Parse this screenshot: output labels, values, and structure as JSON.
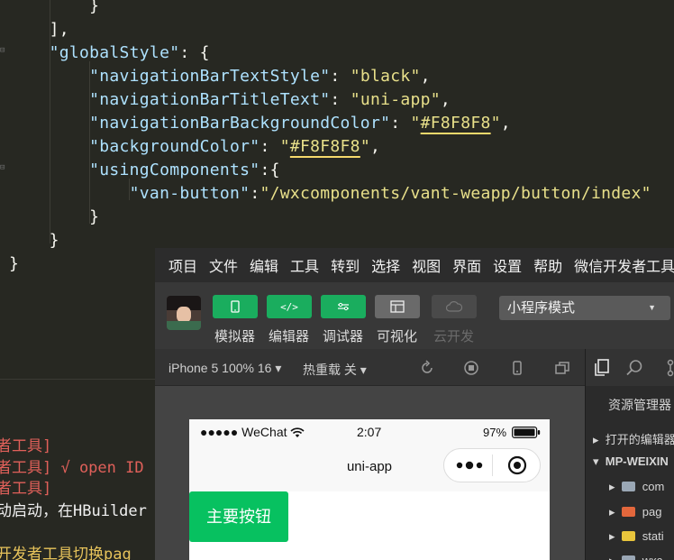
{
  "editor": {
    "lines": [
      {
        "indent": "        ",
        "parts": [
          {
            "t": "}",
            "c": "p"
          }
        ]
      },
      {
        "indent": "    ",
        "parts": [
          {
            "t": "],",
            "c": "p"
          }
        ]
      },
      {
        "indent": "    ",
        "parts": [
          {
            "t": "\"globalStyle\"",
            "c": "k"
          },
          {
            "t": ": {",
            "c": "p"
          }
        ]
      },
      {
        "indent": "        ",
        "parts": [
          {
            "t": "\"navigationBarTextStyle\"",
            "c": "k"
          },
          {
            "t": ": ",
            "c": "p"
          },
          {
            "t": "\"black\"",
            "c": "s"
          },
          {
            "t": ",",
            "c": "p"
          }
        ]
      },
      {
        "indent": "        ",
        "parts": [
          {
            "t": "\"navigationBarTitleText\"",
            "c": "k"
          },
          {
            "t": ": ",
            "c": "p"
          },
          {
            "t": "\"uni-app\"",
            "c": "s"
          },
          {
            "t": ",",
            "c": "p"
          }
        ]
      },
      {
        "indent": "        ",
        "parts": [
          {
            "t": "\"navigationBarBackgroundColor\"",
            "c": "k"
          },
          {
            "t": ": ",
            "c": "p"
          },
          {
            "t": "\"",
            "c": "s"
          },
          {
            "t": "#F8F8F8",
            "c": "s ul"
          },
          {
            "t": "\"",
            "c": "s"
          },
          {
            "t": ",",
            "c": "p"
          }
        ]
      },
      {
        "indent": "        ",
        "parts": [
          {
            "t": "\"backgroundColor\"",
            "c": "k"
          },
          {
            "t": ": ",
            "c": "p"
          },
          {
            "t": "\"",
            "c": "s"
          },
          {
            "t": "#F8F8F8",
            "c": "s ul"
          },
          {
            "t": "\"",
            "c": "s"
          },
          {
            "t": ",",
            "c": "p"
          }
        ]
      },
      {
        "indent": "        ",
        "parts": [
          {
            "t": "\"usingComponents\"",
            "c": "k"
          },
          {
            "t": ":{",
            "c": "p"
          }
        ]
      },
      {
        "indent": "            ",
        "parts": [
          {
            "t": "\"van-button\"",
            "c": "k"
          },
          {
            "t": ":",
            "c": "p"
          },
          {
            "t": "\"/wxcomponents/vant-weapp/button/index\"",
            "c": "s"
          }
        ]
      },
      {
        "indent": "        ",
        "parts": [
          {
            "t": "}",
            "c": "p"
          }
        ]
      },
      {
        "indent": "    ",
        "parts": [
          {
            "t": "}",
            "c": "p"
          }
        ]
      },
      {
        "indent": "",
        "parts": [
          {
            "t": "}",
            "c": "p"
          }
        ]
      }
    ]
  },
  "console": {
    "lines": [
      {
        "t": "者工具]",
        "c": "red"
      },
      {
        "t": "者工具] √ open ID",
        "c": "red"
      },
      {
        "t": "者工具]",
        "c": "red"
      },
      {
        "t": "动启动，在HBuilder",
        "c": "wht"
      },
      {
        "t": "",
        "c": "wht"
      },
      {
        "t": "开发者工具切换pag",
        "c": "yel"
      }
    ]
  },
  "devtools": {
    "menu": [
      "项目",
      "文件",
      "编辑",
      "工具",
      "转到",
      "选择",
      "视图",
      "界面",
      "设置",
      "帮助",
      "微信开发者工具"
    ],
    "toolbar": {
      "simulator": "模拟器",
      "editor": "编辑器",
      "debugger": "调试器",
      "visualize": "可视化",
      "cloud": "云开发",
      "mode": "小程序模式"
    },
    "subbar": {
      "device": "iPhone 5 100% 16 ▾",
      "hotreload": "热重载 关 ▾"
    },
    "phone": {
      "carrier": "●●●●● WeChat",
      "time": "2:07",
      "battery": "97%",
      "title": "uni-app",
      "button": "主要按钮"
    },
    "files": {
      "title": "资源管理器",
      "open_editors": "打开的编辑器",
      "project": "MP-WEIXIN",
      "items": [
        "com",
        "pag",
        "stati",
        "wxc"
      ]
    }
  },
  "colors": {
    "editor_bg": "#272822",
    "key": "#aee2ff",
    "string": "#e8e08a",
    "wechat_green": "#07c160",
    "toolbar_green": "#1aad5e"
  }
}
